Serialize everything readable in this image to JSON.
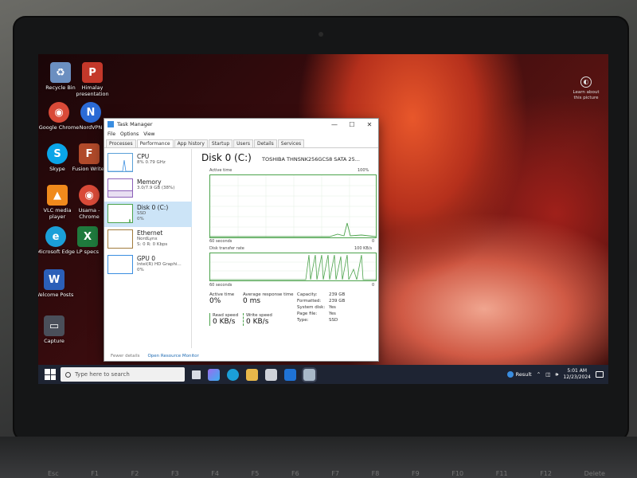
{
  "desktop": {
    "icons": [
      {
        "label": "Recycle Bin",
        "color": "#6b8fc0",
        "glyph": "♻"
      },
      {
        "label": "Himalay presentation",
        "color": "#c4382a",
        "glyph": "P"
      },
      {
        "label": "Google Chrome",
        "color": "#d94a38",
        "glyph": "◉"
      },
      {
        "label": "NordVPN",
        "color": "#2b6bd6",
        "glyph": "N"
      },
      {
        "label": "Skype",
        "color": "#0aa5e8",
        "glyph": "S"
      },
      {
        "label": "Fusion Writer",
        "color": "#b04a2a",
        "glyph": "F"
      },
      {
        "label": "VLC media player",
        "color": "#f08a1c",
        "glyph": "▲"
      },
      {
        "label": "Usama - Chrome",
        "color": "#d94a38",
        "glyph": "◉"
      },
      {
        "label": "Microsoft Edge",
        "color": "#1b9fd8",
        "glyph": "e"
      },
      {
        "label": "LP specs",
        "color": "#1f7a3d",
        "glyph": "X"
      },
      {
        "label": "Welcome Posts",
        "color": "#2b5fb8",
        "glyph": "W"
      },
      {
        "label": "Capture",
        "color": "#4a4f5a",
        "glyph": "▭"
      }
    ],
    "learn_about_label": "Learn about this picture"
  },
  "task_manager": {
    "title": "Task Manager",
    "controls": {
      "minimize": "—",
      "maximize": "☐",
      "close": "✕"
    },
    "menu": [
      "File",
      "Options",
      "View"
    ],
    "tabs": [
      "Processes",
      "Performance",
      "App history",
      "Startup",
      "Users",
      "Details",
      "Services"
    ],
    "active_tab": "Performance",
    "resources": [
      {
        "name": "CPU",
        "sub1": "8% 0.79 GHz",
        "sub2": ""
      },
      {
        "name": "Memory",
        "sub1": "3.0/7.9 GB (38%)",
        "sub2": ""
      },
      {
        "name": "Disk 0 (C:)",
        "sub1": "SSD",
        "sub2": "0%"
      },
      {
        "name": "Ethernet",
        "sub1": "NordLynx",
        "sub2": "S: 0 R: 0 Kbps"
      },
      {
        "name": "GPU 0",
        "sub1": "Intel(R) HD Graphi...",
        "sub2": "0%"
      }
    ],
    "selected_resource": "Disk 0 (C:)",
    "detail": {
      "title": "Disk 0 (C:)",
      "model": "TOSHIBA THNSNK256GCS8 SATA 25...",
      "active_time_label": "Active time",
      "active_time_max": "100%",
      "graph1_time": "60 seconds",
      "graph1_min": "0",
      "transfer_label": "Disk transfer rate",
      "transfer_max": "100 KB/s",
      "graph2_time": "60 seconds",
      "graph2_min": "0",
      "stats": {
        "active_time": {
          "label": "Active time",
          "value": "0%"
        },
        "avg_response": {
          "label": "Average response time",
          "value": "0 ms"
        },
        "read_speed": {
          "label": "Read speed",
          "value": "0 KB/s"
        },
        "write_speed": {
          "label": "Write speed",
          "value": "0 KB/s"
        }
      },
      "properties": [
        {
          "key": "Capacity:",
          "value": "239 GB"
        },
        {
          "key": "Formatted:",
          "value": "239 GB"
        },
        {
          "key": "System disk:",
          "value": "Yes"
        },
        {
          "key": "Page file:",
          "value": "Yes"
        },
        {
          "key": "Type:",
          "value": "SSD"
        }
      ]
    },
    "footer": {
      "fewer_details": "Fewer details",
      "open_monitor": "Open Resource Monitor"
    }
  },
  "taskbar": {
    "search_placeholder": "Type here to search",
    "apps": [
      {
        "name": "task-view",
        "color": "#ffffff"
      },
      {
        "name": "copilot",
        "color": "#9b6cf0"
      },
      {
        "name": "edge",
        "color": "#1b9fd8"
      },
      {
        "name": "file-explorer",
        "color": "#e8b84a"
      },
      {
        "name": "store",
        "color": "#cfd3da"
      },
      {
        "name": "outlook",
        "color": "#1f73d6"
      },
      {
        "name": "task-manager",
        "color": "#a8b8c8"
      }
    ],
    "weather": "Result",
    "time": "5:01 AM",
    "date": "12/23/2024"
  }
}
